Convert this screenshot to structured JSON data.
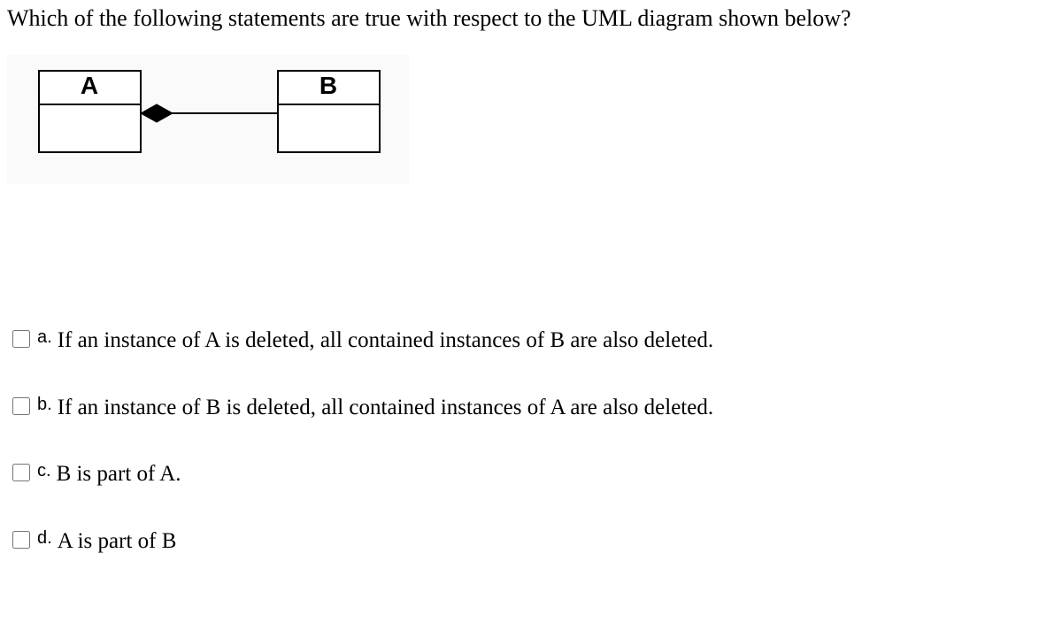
{
  "question": "Which of the following statements are true with respect to the UML diagram shown below?",
  "diagram": {
    "leftClass": "A",
    "rightClass": "B",
    "relation": "composition-diamond-at-A"
  },
  "options": [
    {
      "letter": "a.",
      "text": "If an instance of A is deleted, all contained instances of B are also deleted."
    },
    {
      "letter": "b.",
      "text": "If an instance of B is deleted, all contained instances of A are also deleted."
    },
    {
      "letter": "c.",
      "text": "B is part of A."
    },
    {
      "letter": "d.",
      "text": "A is part of B"
    }
  ]
}
